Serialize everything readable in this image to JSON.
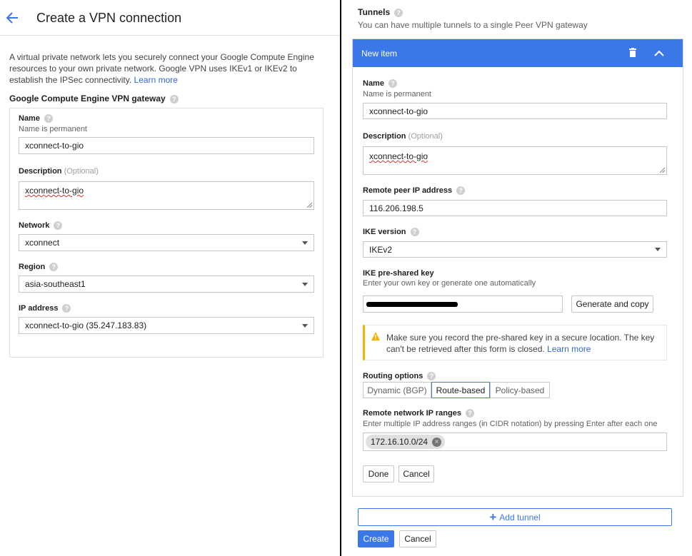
{
  "left": {
    "page_title": "Create a VPN connection",
    "intro": "A virtual private network lets you securely connect your Google Compute Engine resources to your own private network. Google VPN uses IKEv1 or IKEv2 to establish the IPSec connectivity.",
    "learn_more": "Learn more",
    "gateway_heading": "Google Compute Engine VPN gateway",
    "name_label": "Name",
    "name_hint": "Name is permanent",
    "name_value": "xconnect-to-gio",
    "description_label": "Description",
    "optional": "(Optional)",
    "description_value": "xconnect-to-gio",
    "network_label": "Network",
    "network_value": "xconnect",
    "region_label": "Region",
    "region_value": "asia-southeast1",
    "ip_label": "IP address",
    "ip_value": "xconnect-to-gio (35.247.183.83)"
  },
  "right": {
    "tunnels_heading": "Tunnels",
    "tunnels_hint": "You can have multiple tunnels to a single Peer VPN gateway",
    "item_title": "New item",
    "name_label": "Name",
    "name_hint": "Name is permanent",
    "name_value": "xconnect-to-gio",
    "description_label": "Description",
    "optional": "(Optional)",
    "description_value": "xconnect-to-gio",
    "peer_ip_label": "Remote peer IP address",
    "peer_ip_value": "116.206.198.5",
    "ike_version_label": "IKE version",
    "ike_version_value": "IKEv2",
    "psk_label": "IKE pre-shared key",
    "psk_hint": "Enter your own key or generate one automatically",
    "generate_button": "Generate and copy",
    "warning_text": "Make sure you record the pre-shared key in a secure location. The key can't be retrieved after this form is closed.",
    "warning_link": "Learn more",
    "routing_label": "Routing options",
    "routing_options": [
      "Dynamic (BGP)",
      "Route-based",
      "Policy-based"
    ],
    "routing_selected": "Route-based",
    "ranges_label": "Remote network IP ranges",
    "ranges_hint": "Enter multiple IP address ranges (in CIDR notation) by pressing Enter after each one",
    "range_chip": "172.16.10.0/24",
    "done_button": "Done",
    "cancel_item_button": "Cancel",
    "add_tunnel_button": "Add tunnel",
    "create_button": "Create",
    "cancel_button": "Cancel"
  },
  "colors": {
    "accent": "#3b78e7",
    "warning": "#f4b400",
    "link": "#3367d6"
  },
  "icons": {
    "back": "arrow-left-icon",
    "help": "help-circle-icon",
    "delete": "trash-icon",
    "collapse": "chevron-up-icon",
    "warning": "warning-triangle-icon",
    "remove_chip": "close-circle-icon",
    "add": "plus-icon"
  }
}
